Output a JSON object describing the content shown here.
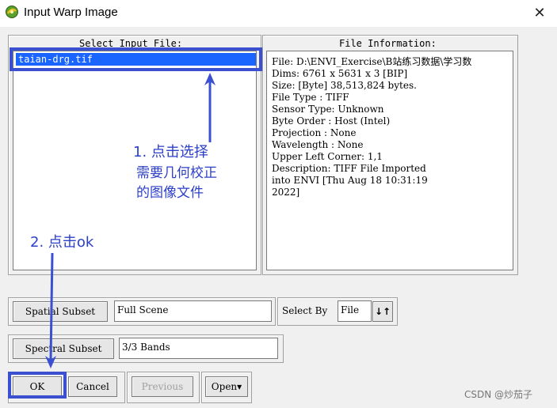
{
  "window": {
    "title": "Input Warp Image",
    "close_glyph": "✕"
  },
  "select_input_file": {
    "legend": "Select Input File:",
    "files": [
      "taian-drg.tif"
    ]
  },
  "file_information": {
    "legend": "File Information:",
    "lines": [
      "File: D:\\ENVI_Exercise\\B站练习数据\\学习数",
      "Dims: 6761 x 5631 x 3 [BIP]",
      "Size: [Byte] 38,513,824 bytes.",
      "File Type  : TIFF",
      "Sensor Type: Unknown",
      "Byte Order : Host (Intel)",
      "Projection : None",
      "Wavelength : None",
      "Upper Left Corner: 1,1",
      "Description: TIFF File Imported",
      "into ENVI [Thu Aug 18 10:31:19",
      "2022]"
    ]
  },
  "spatial_subset": {
    "button": "Spatial Subset",
    "value": "Full Scene"
  },
  "select_by": {
    "label": "Select By",
    "value": "File",
    "sort_icon": "↓↑"
  },
  "spectral_subset": {
    "button": "Spectral Subset",
    "value": "3/3 Bands"
  },
  "buttons": {
    "ok": "OK",
    "cancel": "Cancel",
    "previous": "Previous",
    "open": "Open",
    "open_arrow": "▾"
  },
  "annotations": {
    "step1_line1": "1. 点击选择",
    "step1_line2": "需要几何校正",
    "step1_line3": "的图像文件",
    "step2": "2. 点击ok",
    "color": "#2c3fc8"
  },
  "watermark": "CSDN @炒茄子"
}
